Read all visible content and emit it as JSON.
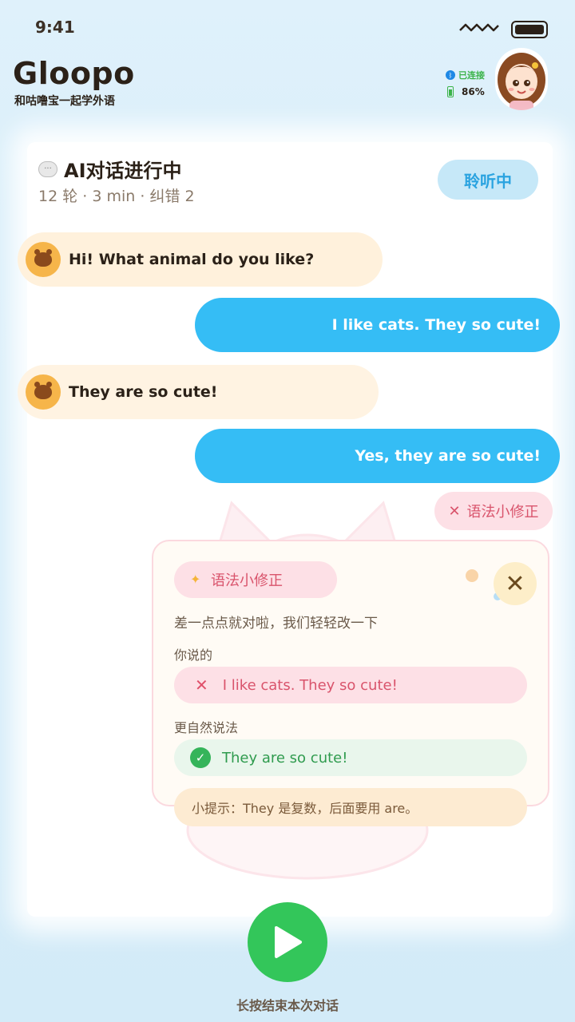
{
  "status_bar": {
    "time": "9:41"
  },
  "header": {
    "title": "Gloopo",
    "subtitle": "和咕噜宝一起学外语",
    "connection": "已连接",
    "battery": "86%"
  },
  "session": {
    "title": "AI对话进行中",
    "meta": "12 轮 · 3 min · 纠错 2",
    "listening_label": "聆听中"
  },
  "messages": [
    {
      "from": "ai",
      "text": "Hi! What animal do you like?"
    },
    {
      "from": "user",
      "text": "I like cats. They so cute!"
    },
    {
      "from": "ai",
      "text": "They are so cute!"
    },
    {
      "from": "user",
      "text": "Yes, they are so cute!"
    }
  ],
  "grammar_tag": "语法小修正",
  "correction": {
    "tag": "语法小修正",
    "intro": "差一点点就对啦，我们轻轻改一下",
    "said_label": "你说的",
    "said_text": "I like cats. They so cute!",
    "better_label": "更自然说法",
    "better_text": "They are so cute!",
    "tip": "小提示：They 是复数，后面要用 are。"
  },
  "bottom": {
    "hint": "长按结束本次对话"
  },
  "colors": {
    "accent_blue": "#35bdf5",
    "green": "#33c65a",
    "pink": "#fde0e6"
  }
}
